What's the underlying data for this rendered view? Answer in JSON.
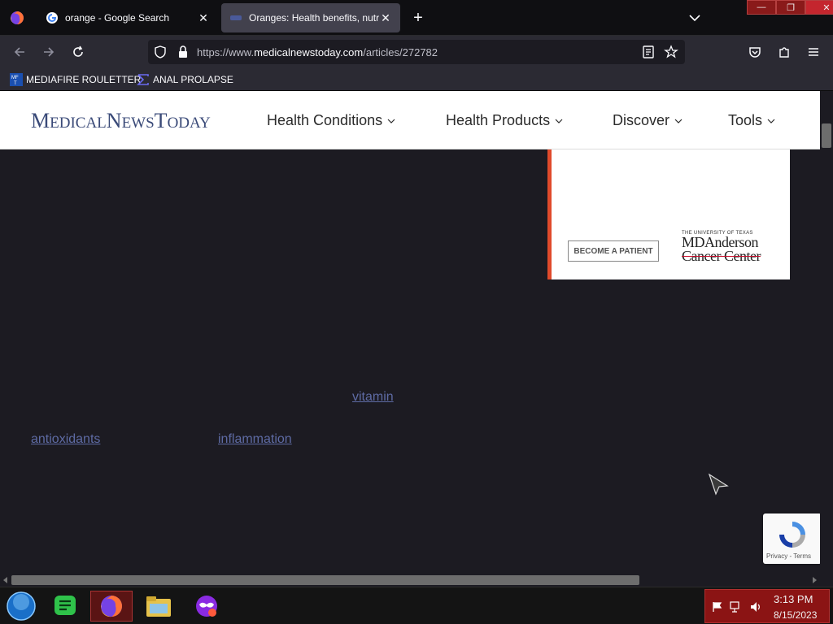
{
  "browser": {
    "tabs": [
      {
        "title": "orange - Google Search",
        "active": false
      },
      {
        "title": "Oranges: Health benefits, nutrit",
        "active": true
      }
    ],
    "url_prefix": "https://www.",
    "url_host": "medicalnewstoday.com",
    "url_path": "/articles/272782",
    "bookmarks": [
      {
        "label": "MEDIAFIRE ROULETTER"
      },
      {
        "label": "ANAL PROLAPSE"
      }
    ]
  },
  "site": {
    "logo_parts": [
      "M",
      "EDICAL",
      "N",
      "EWS",
      "T",
      "ODAY"
    ],
    "nav": [
      "Health Conditions",
      "Health Products",
      "Discover",
      "Tools"
    ]
  },
  "ad": {
    "button_label": "BECOME A PATIENT",
    "org_line": "THE UNIVERSITY OF TEXAS",
    "name_line1": "MDAnderson",
    "name_line2": "Cancer Center",
    "accent": "#e04a2b"
  },
  "article_links": [
    "vitamin",
    "antioxidants",
    "inflammation"
  ],
  "recaptcha": {
    "privacy": "Privacy",
    "sep": " - ",
    "terms": "Terms"
  },
  "taskbar": {
    "time": "3:13 PM",
    "date": "8/15/2023"
  }
}
